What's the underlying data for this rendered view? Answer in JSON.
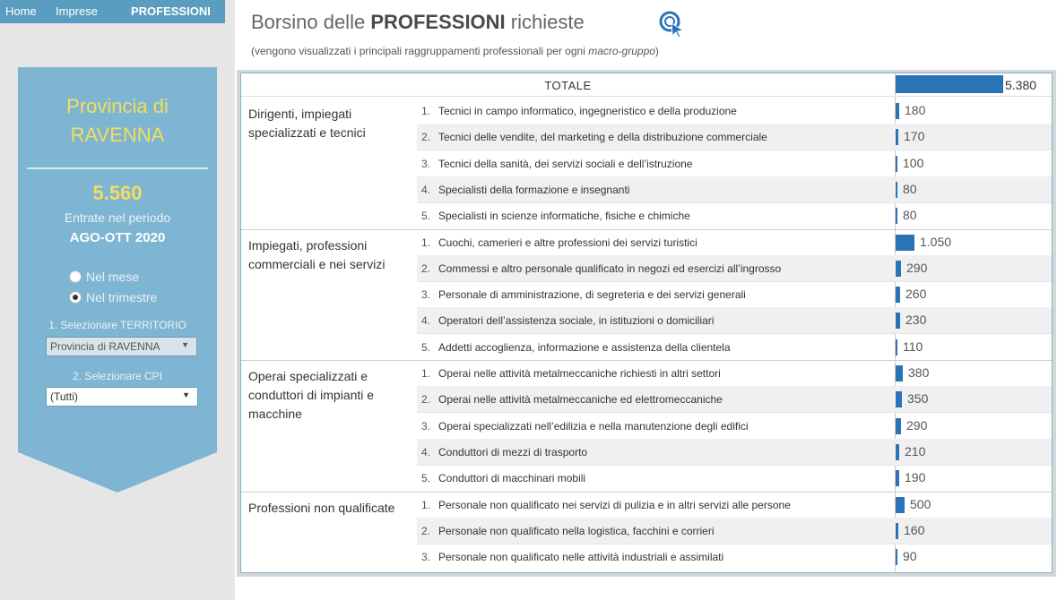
{
  "nav": {
    "home": "Home",
    "imprese": "Imprese",
    "professioni": "PROFESSIONI"
  },
  "sidebar": {
    "province_line1": "Provincia di",
    "province_line2": "RAVENNA",
    "total_entrate": "5.560",
    "entrate_label": "Entrate nel periodo",
    "period": "AGO-OTT 2020",
    "radio_month": "Nel mese",
    "radio_quarter": "Nel trimestre",
    "radio_selected": "Nel trimestre",
    "select_territorio_label": "1. Selezionare TERRITORIO",
    "territorio_value": "Provincia di RAVENNA",
    "select_cpi_label": "2. Selezionare CPI",
    "cpi_value": "(Tutti)"
  },
  "header": {
    "title_pre": "Borsino delle ",
    "title_bold": "PROFESSIONI",
    "title_post": " richieste",
    "subtitle_pre": "(vengono visualizzati i principali raggruppamenti professionali per ogni ",
    "subtitle_em": "macro-gruppo",
    "subtitle_post": ")"
  },
  "table": {
    "total_label": "TOTALE",
    "total_value": "5.380",
    "total_number": 5380,
    "groups": [
      {
        "label": "Dirigenti, impiegati specializzati e tecnici",
        "rows": [
          {
            "num": "1.",
            "desc": "Tecnici in campo informatico, ingegneristico e della produzione",
            "value": "180",
            "n": 180
          },
          {
            "num": "2.",
            "desc": "Tecnici delle vendite, del marketing e della distribuzione commerciale",
            "value": "170",
            "n": 170
          },
          {
            "num": "3.",
            "desc": "Tecnici della sanità, dei servizi sociali e dell’istruzione",
            "value": "100",
            "n": 100
          },
          {
            "num": "4.",
            "desc": "Specialisti della formazione e insegnanti",
            "value": "80",
            "n": 80
          },
          {
            "num": "5.",
            "desc": "Specialisti in scienze informatiche, fisiche e chimiche",
            "value": "80",
            "n": 80
          }
        ]
      },
      {
        "label": "Impiegati, professioni commerciali e nei servizi",
        "rows": [
          {
            "num": "1.",
            "desc": "Cuochi, camerieri e altre professioni dei servizi turistici",
            "value": "1.050",
            "n": 1050
          },
          {
            "num": "2.",
            "desc": "Commessi e altro personale qualificato in negozi ed esercizi all’ingrosso",
            "value": "290",
            "n": 290
          },
          {
            "num": "3.",
            "desc": "Personale di amministrazione, di segreteria e dei servizi generali",
            "value": "260",
            "n": 260
          },
          {
            "num": "4.",
            "desc": "Operatori dell’assistenza sociale, in istituzioni o domiciliari",
            "value": "230",
            "n": 230
          },
          {
            "num": "5.",
            "desc": "Addetti accoglienza, informazione e assistenza della clientela",
            "value": "110",
            "n": 110
          }
        ]
      },
      {
        "label": "Operai specializzati e conduttori di impianti e macchine",
        "rows": [
          {
            "num": "1.",
            "desc": "Operai nelle attività metalmeccaniche richiesti in altri settori",
            "value": "380",
            "n": 380
          },
          {
            "num": "2.",
            "desc": "Operai nelle attività metalmeccaniche ed elettromeccaniche",
            "value": "350",
            "n": 350
          },
          {
            "num": "3.",
            "desc": "Operai specializzati nell’edilizia e nella manutenzione degli edifici",
            "value": "290",
            "n": 290
          },
          {
            "num": "4.",
            "desc": "Conduttori di mezzi di trasporto",
            "value": "210",
            "n": 210
          },
          {
            "num": "5.",
            "desc": "Conduttori di macchinari mobili",
            "value": "190",
            "n": 190
          }
        ]
      },
      {
        "label": "Professioni non qualificate",
        "rows": [
          {
            "num": "1.",
            "desc": "Personale non qualificato nei servizi di pulizia e in altri servizi alle persone",
            "value": "500",
            "n": 500
          },
          {
            "num": "2.",
            "desc": "Personale non qualificato nella logistica, facchini e corrieri",
            "value": "160",
            "n": 160
          },
          {
            "num": "3.",
            "desc": "Personale non qualificato nelle attività industriali e assimilati",
            "value": "90",
            "n": 90
          }
        ]
      }
    ]
  },
  "colors": {
    "bar": "#2a73b7",
    "accent_yellow": "#f4dd5c",
    "panel": "#7eb5d2",
    "nav": "#5b9dc1"
  },
  "icons": {
    "search": "search-cursor-icon",
    "dropdown": "chevron-down-icon"
  }
}
